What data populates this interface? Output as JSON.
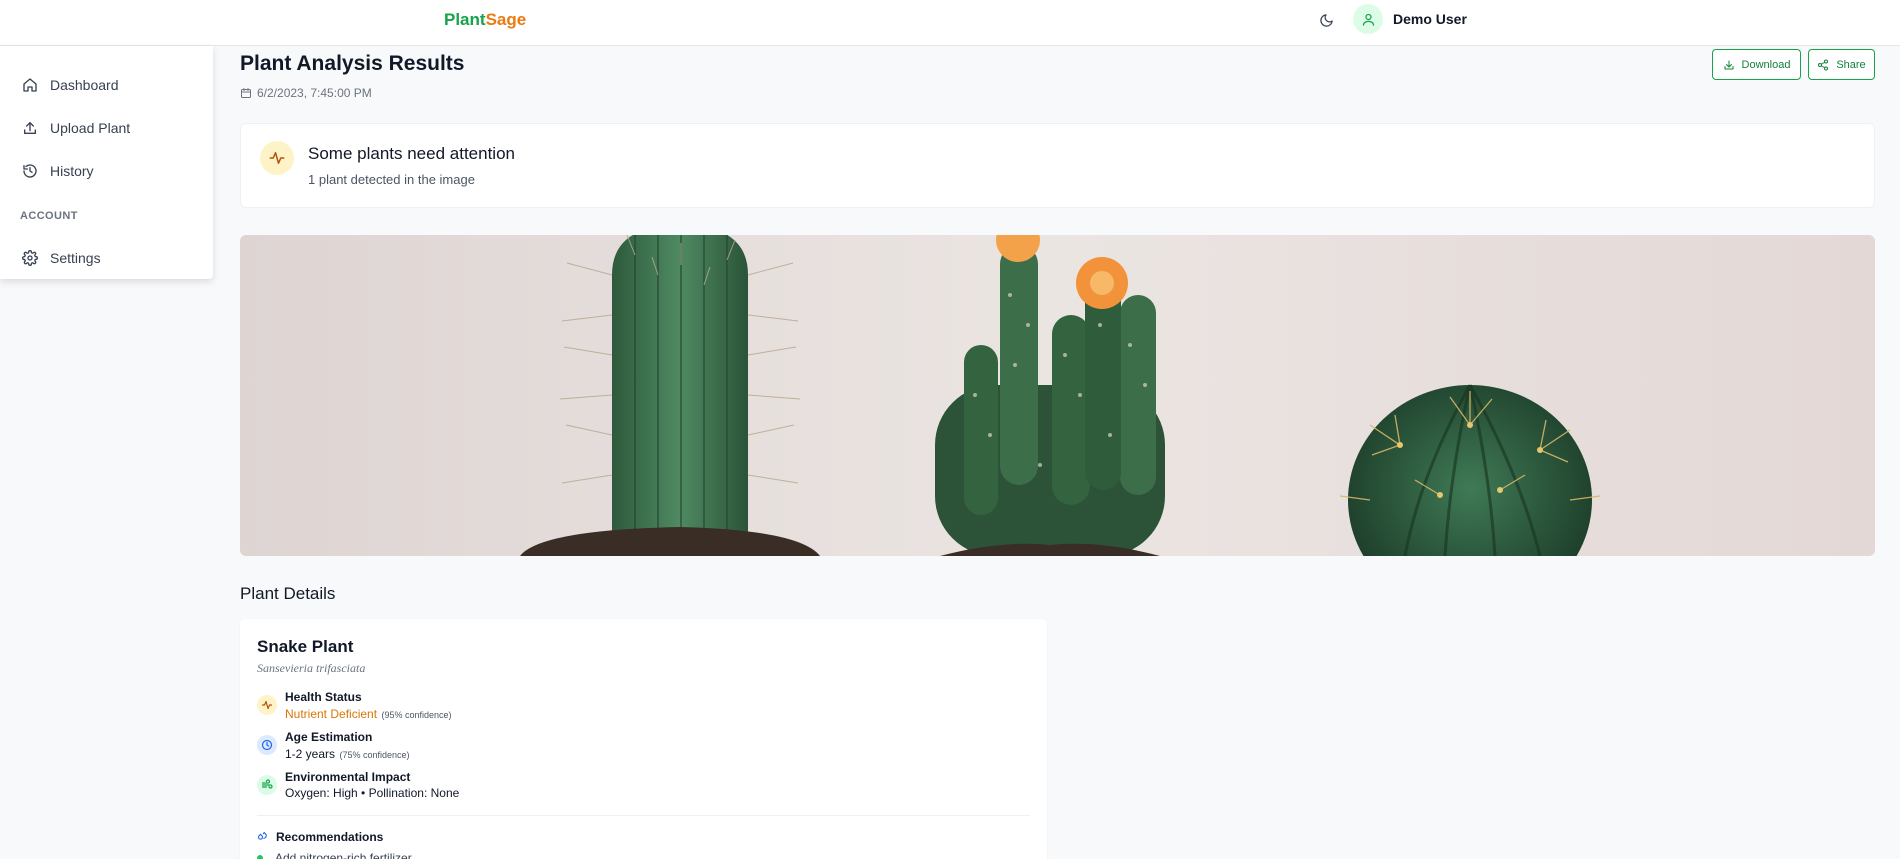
{
  "header": {
    "brand_part1": "Plant",
    "brand_part2": "Sage",
    "theme_icon": "moon-icon",
    "user_name": "Demo User",
    "user_icon": "user-icon"
  },
  "sidebar": {
    "items": [
      {
        "label": "Dashboard",
        "icon": "home-icon"
      },
      {
        "label": "Upload Plant",
        "icon": "upload-icon"
      },
      {
        "label": "History",
        "icon": "history-icon"
      }
    ],
    "section_label": "ACCOUNT",
    "account_items": [
      {
        "label": "Settings",
        "icon": "gear-icon"
      }
    ]
  },
  "page": {
    "title": "Plant Analysis Results",
    "date": "6/2/2023, 7:45:00 PM",
    "download_label": "Download",
    "share_label": "Share"
  },
  "alert": {
    "title": "Some plants need attention",
    "subtitle": "1 plant detected in the image",
    "icon": "activity-icon"
  },
  "details": {
    "section_title": "Plant Details",
    "plant": {
      "name": "Snake Plant",
      "scientific_name": "Sansevieria trifasciata",
      "health": {
        "label": "Health Status",
        "value": "Nutrient Deficient",
        "confidence": "(95% confidence)"
      },
      "age": {
        "label": "Age Estimation",
        "value": "1-2 years",
        "confidence": "(75% confidence)"
      },
      "environment": {
        "label": "Environmental Impact",
        "value": "Oxygen: High • Pollination: None"
      },
      "recommendations_title": "Recommendations",
      "recommendations": [
        "Add nitrogen-rich fertilizer"
      ]
    }
  },
  "colors": {
    "brand_green": "#16a34a",
    "brand_orange": "#ea7a12",
    "warning": "#d97706",
    "background": "#f8f9fb"
  }
}
